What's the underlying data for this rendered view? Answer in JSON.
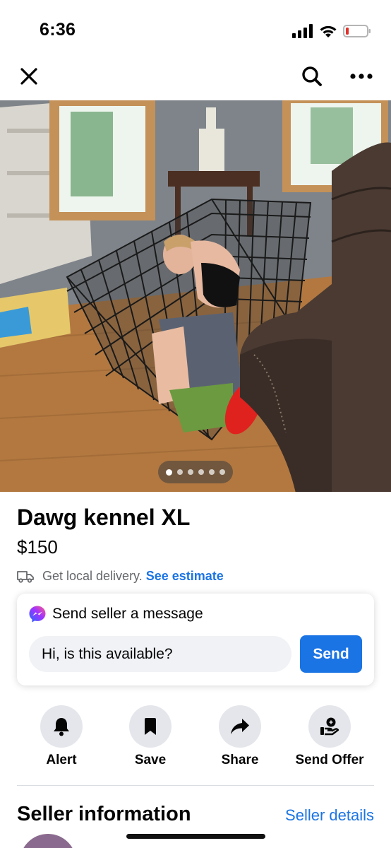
{
  "status_bar": {
    "time": "6:36",
    "battery_color": "#e0312b"
  },
  "top_nav": {
    "close_icon": "close-icon",
    "search_icon": "search-icon",
    "more_icon": "more-icon"
  },
  "photo": {
    "pager_dots": 6,
    "active_dot": 0
  },
  "listing": {
    "title": "Dawg kennel XL",
    "price": "$150",
    "delivery_text": "Get local delivery.",
    "delivery_link": "See estimate"
  },
  "message": {
    "header": "Send seller a message",
    "input_value": "Hi, is this available?",
    "send_label": "Send"
  },
  "actions": [
    {
      "label": "Alert",
      "icon": "bell-icon"
    },
    {
      "label": "Save",
      "icon": "bookmark-icon"
    },
    {
      "label": "Share",
      "icon": "share-icon"
    },
    {
      "label": "Send Offer",
      "icon": "offer-icon"
    }
  ],
  "seller": {
    "title": "Seller information",
    "details_link": "Seller details"
  },
  "colors": {
    "accent": "#1b74e4",
    "text": "#050505",
    "muted": "#65676b",
    "chip": "#e4e6eb"
  }
}
